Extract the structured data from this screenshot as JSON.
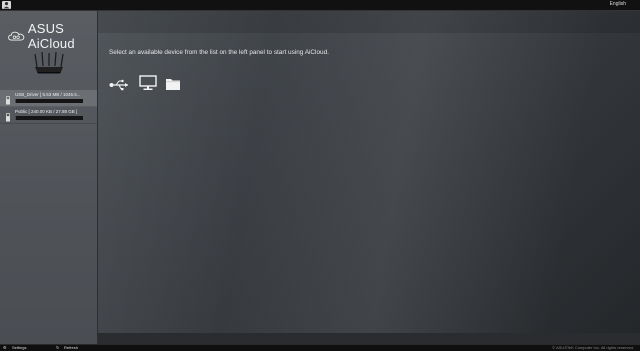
{
  "topbar": {
    "language": "English"
  },
  "sidebar": {
    "brand": "ASUS AiCloud",
    "devices": [
      {
        "label": "USB_Driver [ 5.53 MB / 1045.5...",
        "usage": 0.01
      },
      {
        "label": "Public [ 240.00 KB / 27.88 GB ]",
        "usage": 0.01
      }
    ]
  },
  "main": {
    "message": "Select an available device from the list on the left panel to start using AiCloud.",
    "icons": [
      "usb-icon",
      "computer-icon",
      "folder-icon"
    ]
  },
  "bottombar": {
    "settings": "Settings",
    "refresh": "Refresh",
    "copyright": "© ASUSTeK Computer Inc. All rights reserved."
  },
  "colors": {
    "usage_bar": "#9c2323",
    "sidebar": "#55595e"
  }
}
